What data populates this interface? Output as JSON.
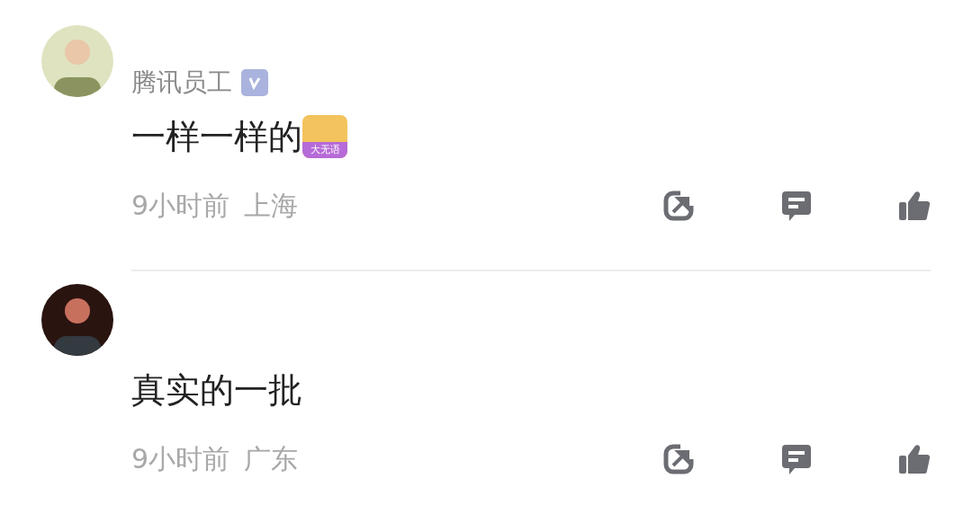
{
  "comments": [
    {
      "badge": {
        "label": "腾讯员工",
        "verified": true
      },
      "text": "一样一样的",
      "sticker": "大无语",
      "time": "9小时前",
      "location": "上海"
    },
    {
      "text": "真实的一批",
      "time": "9小时前",
      "location": "广东"
    }
  ]
}
